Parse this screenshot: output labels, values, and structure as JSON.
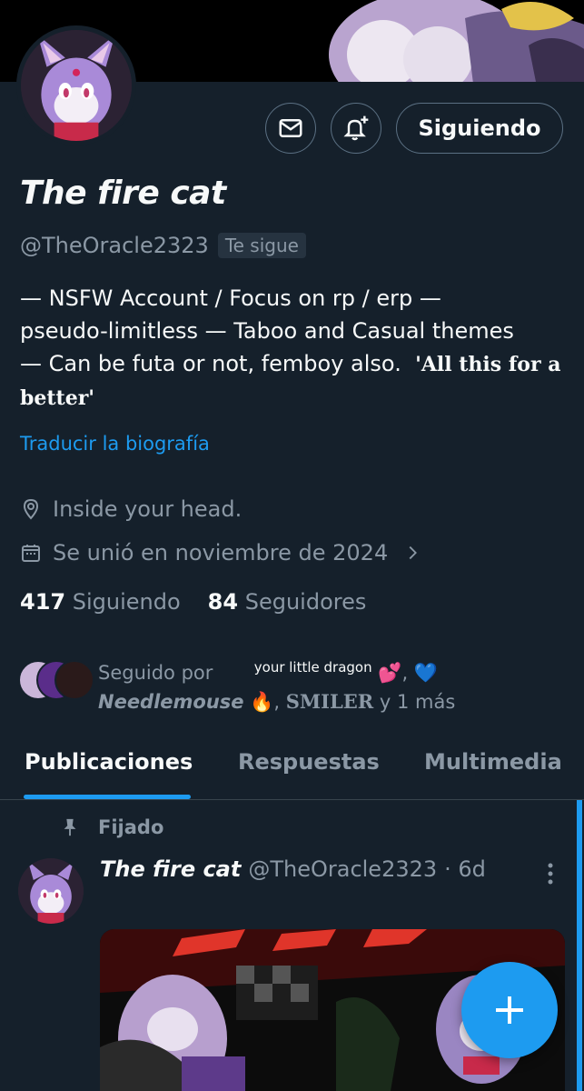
{
  "profile": {
    "display_name": "The fire cat",
    "handle": "@TheOracle2323",
    "follows_you": "Te sigue",
    "bio_line1": "— NSFW Account / Focus on rp / erp —",
    "bio_line2": "pseudo-limitless  — Taboo and Casual themes",
    "bio_line3": "— Can be futa or not, femboy also.",
    "bio_styled_a": "'All this for a",
    "bio_styled_b": "better'",
    "translate_link": "Traducir la biografía",
    "location": "Inside your head.",
    "joined": "Se unió en noviembre de 2024"
  },
  "buttons": {
    "follow_label": "Siguiendo",
    "message_icon": "envelope-icon",
    "notify_icon": "bell-plus-icon"
  },
  "stats": {
    "following_count": "417",
    "following_label": "Siguiendo",
    "followers_count": "84",
    "followers_label": "Seguidores"
  },
  "followed_by": {
    "prefix": "Seguido por",
    "name1": "Needlemouse",
    "name1_emoji": "🔥",
    "name2_prefix": "your little dragon",
    "name2_emoji": "💕",
    "name2_extra": ", 💙",
    "name3": "SMILER",
    "suffix": "y 1 más"
  },
  "tabs": [
    "Publicaciones",
    "Respuestas",
    "Multimedia"
  ],
  "post": {
    "pinned_label": "Fijado",
    "author_name": "The fire cat",
    "author_handle": "@TheOracle2323",
    "time": "· 6d"
  },
  "colors": {
    "background": "#15202b",
    "accent": "#1d9bf0",
    "muted": "#8b98a5",
    "border": "#38444d"
  }
}
